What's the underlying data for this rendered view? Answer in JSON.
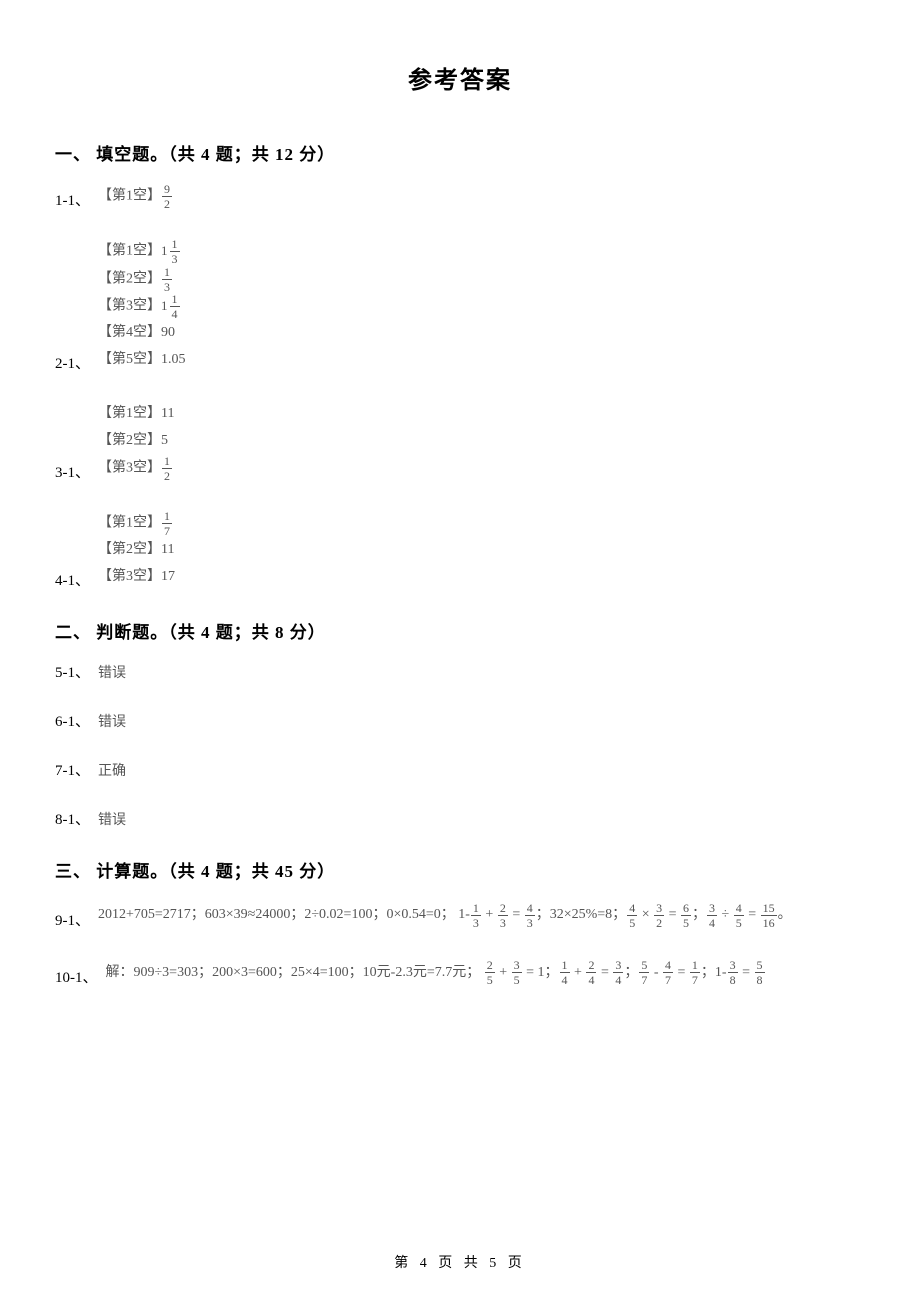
{
  "title": "参考答案",
  "sections": {
    "one": {
      "heading": "一、 填空题。（共 4 题；共 12 分）",
      "items": {
        "i1": {
          "num": "1-1、",
          "blanks": [
            "【第1空】"
          ],
          "frac1": {
            "n": "9",
            "d": "2"
          }
        },
        "i2": {
          "num": "2-1、",
          "l1_label": "【第1空】",
          "l1_mixed_whole": "1",
          "l1_mixed_n": "1",
          "l1_mixed_d": "3",
          "l2_label": "【第2空】",
          "l2_n": "1",
          "l2_d": "3",
          "l3_label": "【第3空】",
          "l3_mixed_whole": "1",
          "l3_mixed_n": "1",
          "l3_mixed_d": "4",
          "l4": "【第4空】90",
          "l5": "【第5空】1.05"
        },
        "i3": {
          "num": "3-1、",
          "l1": "【第1空】11",
          "l2": "【第2空】5",
          "l3_label": "【第3空】",
          "l3_n": "1",
          "l3_d": "2"
        },
        "i4": {
          "num": "4-1、",
          "l1_label": "【第1空】",
          "l1_n": "1",
          "l1_d": "7",
          "l2": "【第2空】11",
          "l3": "【第3空】17"
        }
      }
    },
    "two": {
      "heading": "二、 判断题。（共 4 题；共 8 分）",
      "items": {
        "i5": {
          "num": "5-1、",
          "ans": "错误"
        },
        "i6": {
          "num": "6-1、",
          "ans": "错误"
        },
        "i7": {
          "num": "7-1、",
          "ans": "正确"
        },
        "i8": {
          "num": "8-1、",
          "ans": "错误"
        }
      }
    },
    "three": {
      "heading": "三、 计算题。（共 4 题；共 45 分）",
      "items": {
        "i9": {
          "num": "9-1、",
          "line1": "2012+705=2717；603×39≈24000；2÷0.02=100；0×0.54=0；",
          "p_a": "1-",
          "f1": {
            "n": "1",
            "d": "3"
          },
          "p_b": " + ",
          "f2": {
            "n": "2",
            "d": "3"
          },
          "p_c": " = ",
          "f3": {
            "n": "4",
            "d": "3"
          },
          "p_d": "；32×25%=8；",
          "f4": {
            "n": "4",
            "d": "5"
          },
          "p_e": " × ",
          "f5": {
            "n": "3",
            "d": "2"
          },
          "p_f": " = ",
          "f6": {
            "n": "6",
            "d": "5"
          },
          "p_g": "；",
          "f7": {
            "n": "3",
            "d": "4"
          },
          "p_h": " ÷ ",
          "f8": {
            "n": "4",
            "d": "5"
          },
          "p_i": " = ",
          "f9": {
            "n": "15",
            "d": "16"
          },
          "p_j": "。"
        },
        "i10": {
          "num": "10-1、",
          "line1": "解：909÷3=303；200×3=600；25×4=100；10元-2.3元=7.7元；",
          "f1": {
            "n": "2",
            "d": "5"
          },
          "p_a": " + ",
          "f2": {
            "n": "3",
            "d": "5"
          },
          "p_b": " = 1；",
          "f3": {
            "n": "1",
            "d": "4"
          },
          "p_c": " + ",
          "f4": {
            "n": "2",
            "d": "4"
          },
          "p_d": " = ",
          "f5": {
            "n": "3",
            "d": "4"
          },
          "p_e": "；",
          "f6": {
            "n": "5",
            "d": "7"
          },
          "p_f": " - ",
          "f7": {
            "n": "4",
            "d": "7"
          },
          "p_g": " = ",
          "f8": {
            "n": "1",
            "d": "7"
          },
          "p_h": "；1-",
          "f9": {
            "n": "3",
            "d": "8"
          },
          "p_i": " = ",
          "f10": {
            "n": "5",
            "d": "8"
          }
        }
      }
    }
  },
  "footer": "第 4 页 共 5 页"
}
